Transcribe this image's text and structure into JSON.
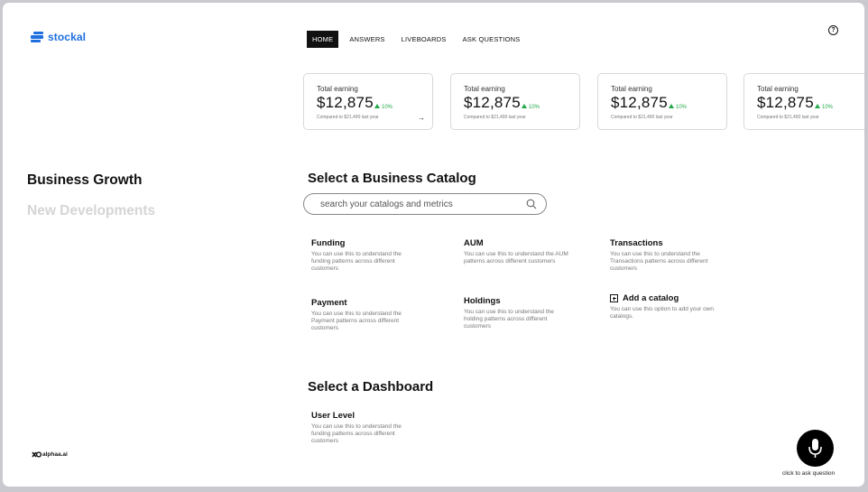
{
  "brand": {
    "name": "stockal",
    "accent": "#1e6fe0"
  },
  "nav": {
    "items": [
      {
        "label": "HOME",
        "active": true
      },
      {
        "label": "ANSWERS",
        "active": false
      },
      {
        "label": "LIVEBOARDS",
        "active": false
      },
      {
        "label": "ASK QUESTIONS",
        "active": false
      }
    ],
    "help_icon": "question-circle-icon"
  },
  "cards": [
    {
      "label": "Total earning",
      "value": "$12,875",
      "change": "10%",
      "note": "Compared to $21,490 last year",
      "has_arrow": true
    },
    {
      "label": "Total earning",
      "value": "$12,875",
      "change": "10%",
      "note": "Compared to $21,490 last year"
    },
    {
      "label": "Total earning",
      "value": "$12,875",
      "change": "10%",
      "note": "Compared to $21,490 last year"
    },
    {
      "label": "Total earning",
      "value": "$12,875",
      "change": "10%",
      "note": "Compared to $21,490 last year"
    }
  ],
  "card_arrow": "→",
  "left_menu": {
    "active": "Business Growth",
    "inactive": "New Developments"
  },
  "catalog_section": {
    "title": "Select a Business Catalog",
    "search_placeholder": "search your catalogs and metrics",
    "items": [
      {
        "title": "Funding",
        "desc": "You can use this to understand the funding patterns across different customers"
      },
      {
        "title": "AUM",
        "desc": "You can use this to understand the AUM patterns across different customers"
      },
      {
        "title": "Transactions",
        "desc": "You can use this to understand the Transactions patterns across different customers"
      },
      {
        "title": "Payment",
        "desc": "You can use this to understand the Payment patterns across different customers"
      },
      {
        "title": "Holdings",
        "desc": "You can use this to understand the holding patterns across different customers"
      },
      {
        "title": "Add a catalog",
        "desc": "You can use this option to add your own catalogs."
      }
    ]
  },
  "dashboard_section": {
    "title": "Select a Dashboard",
    "items": [
      {
        "title": "User Level",
        "desc": "You can use this to understand the funding patterns across different customers"
      }
    ]
  },
  "footer_brand": "alphaa.ai",
  "mic": {
    "caption": "click to ask question",
    "icon": "microphone-icon"
  },
  "colors": {
    "positive": "#22a94a",
    "muted_text": "#777777",
    "inactive_heading": "#d5d5d5"
  }
}
